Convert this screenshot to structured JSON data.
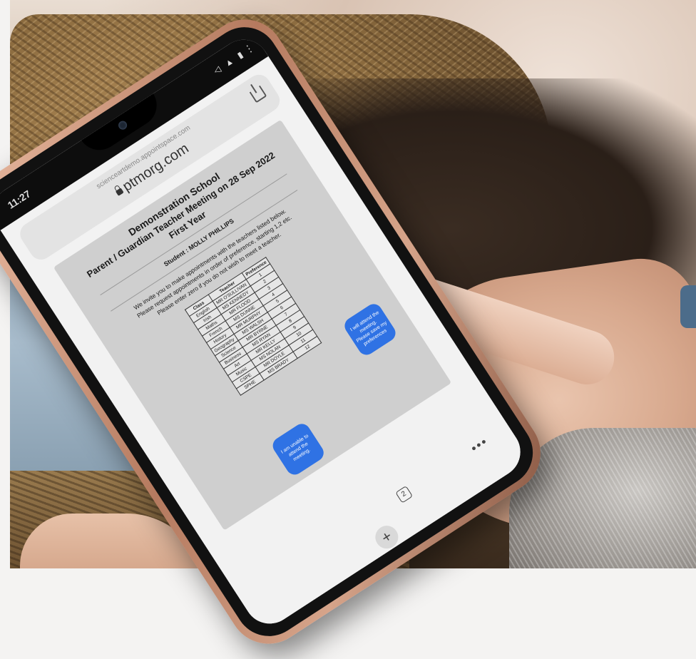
{
  "phone": {
    "status_time": "11:27",
    "status_icons": "◁ ▲ ▮",
    "menu_dots": "⋮",
    "url_subdomain": "scienceartdemo.appointspace.com",
    "url_domain": "ptmorg.com"
  },
  "document": {
    "school_name": "Demonstration School",
    "meeting_title": "Parent / Guardian Teacher Meeting on 28 Sep 2022",
    "year": "First Year",
    "student_line": "Student : MOLLY PHILLIPS",
    "instruction_1": "We invite you to make appointments with the teachers listed below.",
    "instruction_2": "Please request appointments in order of preference, starting 1,2 etc.",
    "instruction_3": "Please enter zero if you do not wish to meet a teacher.",
    "table": {
      "headers": [
        "Class",
        "Teacher",
        "Preference"
      ],
      "rows": [
        [
          "English",
          "MR O'SULLIVAN",
          "1"
        ],
        [
          "Irish",
          "MS KENNEDY",
          "2"
        ],
        [
          "Maths",
          "MR FLOOD",
          "3"
        ],
        [
          "French",
          "MS DUNNE",
          "4"
        ],
        [
          "History",
          "MR MURPHY",
          "5"
        ],
        [
          "Geography",
          "MS WALSH",
          "6"
        ],
        [
          "Science",
          "MR BYRNE",
          "7"
        ],
        [
          "Business",
          "MS RYAN",
          "8"
        ],
        [
          "Art",
          "MR KELLY",
          "9"
        ],
        [
          "Music",
          "MS NOLAN",
          "10"
        ],
        [
          "CSPE",
          "MR DOYLE",
          "11"
        ],
        [
          "SPHE",
          "MS BRADY",
          "12"
        ]
      ]
    },
    "attend_button": "I will attend the meeting. Please save my preferences",
    "unable_button": "I am unable to attend the meeting."
  },
  "browser": {
    "tabs_count": "2",
    "more": "•••",
    "plus": "+"
  }
}
